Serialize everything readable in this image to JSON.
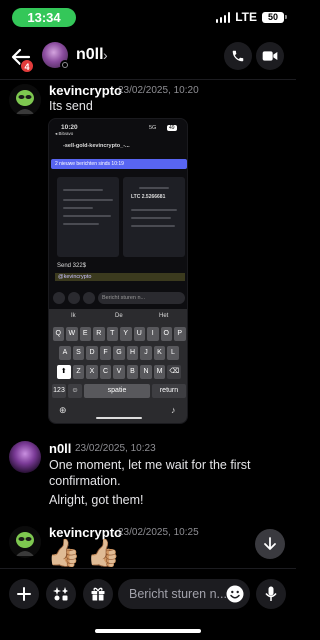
{
  "status_bar": {
    "time": "13:34",
    "network": "LTE",
    "battery": "50"
  },
  "header": {
    "back_badge": "4",
    "name": "n0ll",
    "chevron": "›",
    "call_icon": "phone-icon",
    "video_icon": "video-camera-icon"
  },
  "messages": [
    {
      "author": "kevincrypto",
      "time": "23/02/2025, 10:20",
      "text": "Its send"
    },
    {
      "author": "n0ll",
      "time": "23/02/2025, 10:23",
      "text": "One moment, let me wait for the first confirmation.",
      "followup": "Alright, got them!"
    },
    {
      "author": "kevincrypto",
      "time": "23/02/2025, 10:25",
      "text": "👍🏼👍🏼"
    }
  ],
  "attachment": {
    "time": "10:20",
    "back_label": "◂ Bitvavo",
    "net": "5G",
    "battery": "49",
    "channel": "-sell-gold-kevincrypto_-...",
    "banner": "2 nieuwe berichten sinds 10:19",
    "embed_title": "LTC 2.5266681",
    "send_text": "Send 322$",
    "mention": "@kevincrypto",
    "input_placeholder": "Bericht sturen n...",
    "suggestions": [
      "Ik",
      "De",
      "Het"
    ],
    "keyboard_rows": [
      [
        "Q",
        "W",
        "E",
        "R",
        "T",
        "Y",
        "U",
        "I",
        "O",
        "P"
      ],
      [
        "A",
        "S",
        "D",
        "F",
        "G",
        "H",
        "J",
        "K",
        "L"
      ],
      [
        "Z",
        "X",
        "C",
        "V",
        "B",
        "N",
        "M"
      ]
    ],
    "key_123": "123",
    "key_space": "spatie",
    "key_return": "return"
  },
  "composer": {
    "placeholder": "Bericht sturen n...",
    "add_icon": "plus-icon",
    "apps_icon": "apps-sparkle-icon",
    "gift_icon": "gift-icon",
    "emoji_icon": "emoji-icon",
    "mic_icon": "microphone-icon"
  },
  "colors": {
    "background": "#000000",
    "accent": "#5865f2",
    "status_pill": "#34c759",
    "badge": "#e23b3b"
  }
}
